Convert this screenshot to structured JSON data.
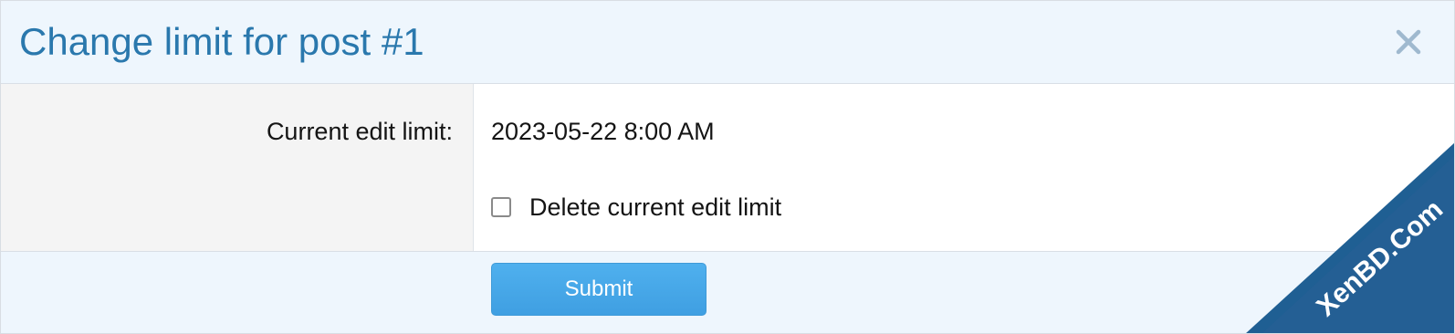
{
  "dialog": {
    "title": "Change limit for post #1",
    "close_icon": "close-icon"
  },
  "form": {
    "current_label": "Current edit limit:",
    "current_value": "2023-05-22 8:00 AM",
    "delete_checkbox": {
      "label": "Delete current edit limit",
      "checked": false
    },
    "submit_label": "Submit"
  },
  "watermark": {
    "text": "XenBD.Com"
  },
  "colors": {
    "title": "#2a78ad",
    "header_bg": "#eef6fd",
    "label_bg": "#f4f4f4",
    "submit_bg": "#46a8ea",
    "watermark_bg": "#1f5f93"
  }
}
